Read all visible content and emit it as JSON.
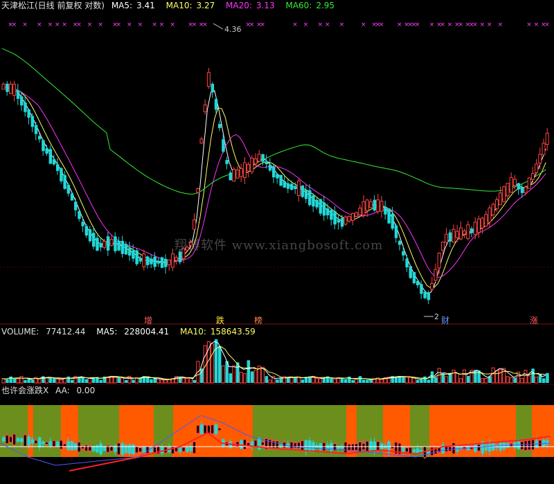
{
  "chart_data": {
    "type": "candlestick",
    "title": "天津松江(日线 前复权 对数)",
    "ma": [
      {
        "name": "MA5",
        "label": "MA5:",
        "value": "3.41",
        "color": "#ffffff"
      },
      {
        "name": "MA10",
        "label": "MA10:",
        "value": "3.27",
        "color": "#ffff66"
      },
      {
        "name": "MA20",
        "label": "MA20:",
        "value": "3.13",
        "color": "#ff33ff"
      },
      {
        "name": "MA60",
        "label": "MA60:",
        "value": "2.95",
        "color": "#33ee33"
      }
    ],
    "annotations": {
      "high": "4.36",
      "low": "2"
    },
    "markers": [
      {
        "text": "增",
        "color": "#ff6060"
      },
      {
        "text": "跌",
        "color": "#ffee33"
      },
      {
        "text": "榜",
        "color": "#ff8844"
      },
      {
        "text": "财",
        "color": "#6699ff"
      },
      {
        "text": "涨",
        "color": "#ff6060"
      }
    ],
    "volume": {
      "label": "VOLUME:",
      "value": "77412.44",
      "ma5_label": "MA5:",
      "ma5_value": "228004.41",
      "ma10_label": "MA10:",
      "ma10_value": "158643.59"
    },
    "indicator": {
      "name": "也许会涨跌X",
      "aa_label": "AA:",
      "aa_value": "0.00"
    }
  },
  "colors": {
    "up": "#ff4444",
    "down": "#22d8d8",
    "ma5": "#ffffff",
    "ma10": "#ffff66",
    "ma20": "#ff33ff",
    "ma60": "#33ee33",
    "zone_green": "#6b8e1d",
    "zone_orange": "#ff5a00",
    "divider": "#aa0000"
  },
  "watermark": "翔博软件 www.xiangbosoft.com"
}
